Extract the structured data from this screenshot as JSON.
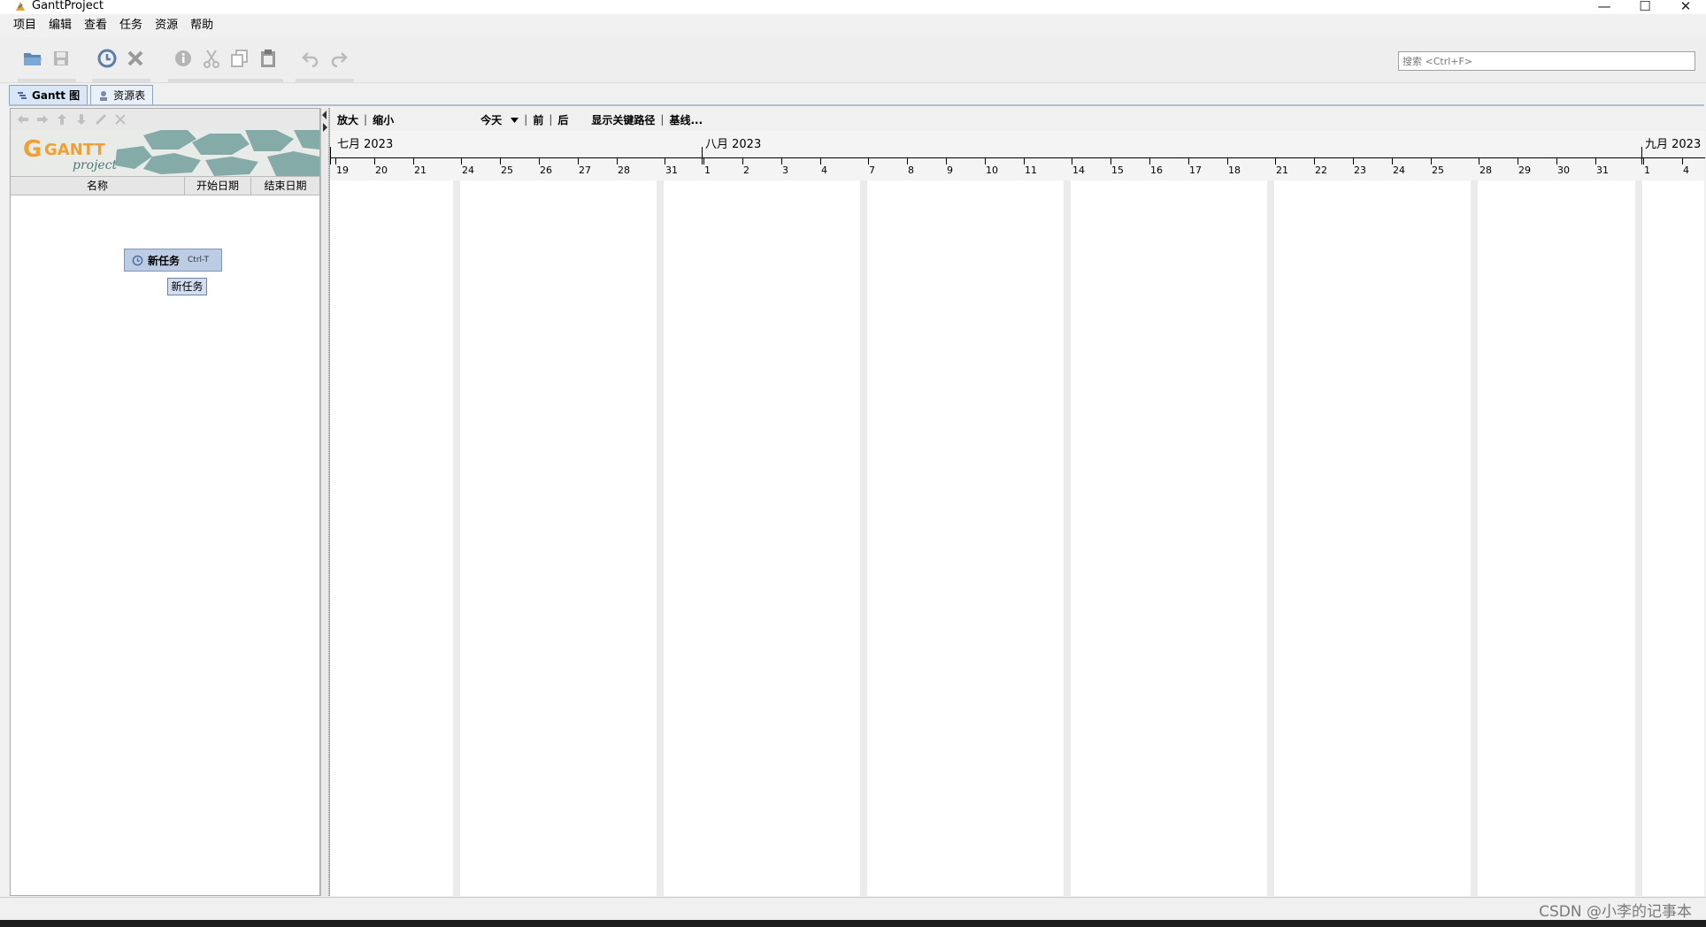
{
  "window": {
    "title": "GanttProject",
    "minimize": "—",
    "maximize": "☐",
    "close": "✕"
  },
  "menu": [
    "项目",
    "编辑",
    "查看",
    "任务",
    "资源",
    "帮助"
  ],
  "search": {
    "placeholder": "搜索 <Ctrl+F>"
  },
  "tabs": [
    {
      "label": "Gantt 图",
      "active": true
    },
    {
      "label": "资源表",
      "active": false
    }
  ],
  "task_table": {
    "columns": [
      "名称",
      "开始日期",
      "结束日期"
    ]
  },
  "logo": {
    "text": "GANTT",
    "subtext": "project"
  },
  "new_task": {
    "label": "新任务",
    "shortcut": "Ctrl-T",
    "tooltip": "新任务"
  },
  "chart_toolbar": {
    "zoom_in": "放大",
    "zoom_out": "缩小",
    "today": "今天",
    "prev": "前",
    "next": "后",
    "critical_path": "显示关键路径",
    "baseline": "基线..."
  },
  "timeline": {
    "months": [
      "七月 2023",
      "八月 2023",
      "九月 2023"
    ],
    "days": [
      "19",
      "20",
      "21",
      "24",
      "25",
      "26",
      "27",
      "28",
      "31",
      "1",
      "2",
      "3",
      "4",
      "7",
      "8",
      "9",
      "10",
      "11",
      "14",
      "15",
      "16",
      "17",
      "18",
      "21",
      "22",
      "23",
      "24",
      "25",
      "28",
      "29",
      "30",
      "31",
      "1",
      "4"
    ]
  },
  "watermark": "CSDN @小李的记事本",
  "colors": {
    "accent": "#d8e6f6",
    "weekend": "#ebebeb",
    "button_bg": "#bccde3"
  }
}
